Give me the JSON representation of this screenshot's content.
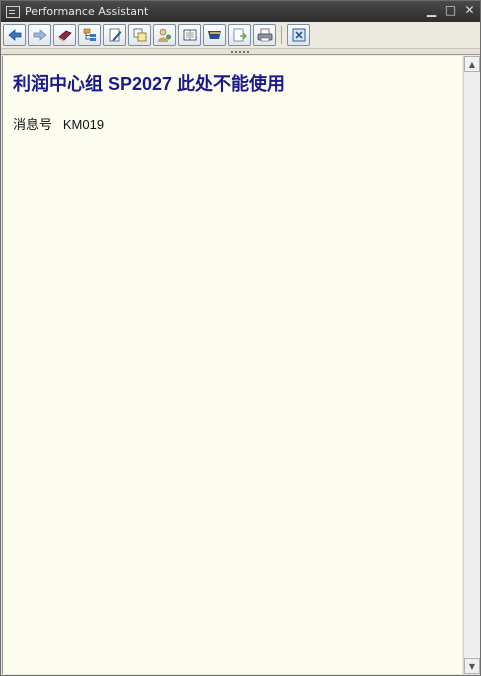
{
  "window": {
    "title": "Performance Assistant",
    "controls": {
      "minimize": "▁",
      "maximize": "□",
      "close": "✕"
    }
  },
  "toolbar": {
    "buttons": [
      {
        "name": "back-button",
        "icon": "arrow-left-icon"
      },
      {
        "name": "forward-button",
        "icon": "arrow-right-icon"
      },
      {
        "name": "book-button",
        "icon": "book-icon"
      },
      {
        "name": "structure-button",
        "icon": "hierarchy-icon"
      },
      {
        "name": "edit-button",
        "icon": "pencil-icon"
      },
      {
        "name": "notes-button",
        "icon": "notes-icon"
      },
      {
        "name": "users-button",
        "icon": "user-icon"
      },
      {
        "name": "document-button",
        "icon": "document-icon"
      },
      {
        "name": "folder-button",
        "icon": "folder-icon"
      },
      {
        "name": "export-button",
        "icon": "export-icon"
      },
      {
        "name": "print-button",
        "icon": "printer-icon"
      },
      {
        "name": "close-button",
        "icon": "close-icon"
      }
    ]
  },
  "content": {
    "heading": "利润中心组  SP2027 此处不能使用",
    "message_label": "消息号",
    "message_number": "KM019"
  },
  "colors": {
    "background": "#fdfdef",
    "heading": "#1a1a8c"
  }
}
